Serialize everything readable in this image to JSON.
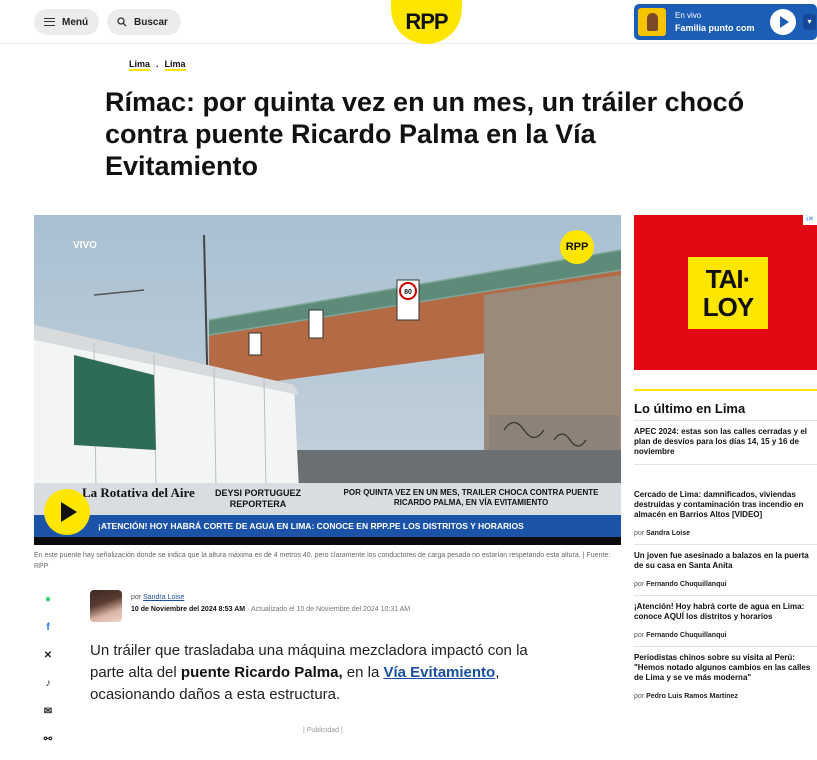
{
  "header": {
    "menu_label": "Menú",
    "search_label": "Buscar",
    "logo": "RPP",
    "live_label": "En vivo",
    "live_program": "Familia punto com"
  },
  "breadcrumb": [
    "Lima",
    "Lima"
  ],
  "article": {
    "title": "Rímac: por quinta vez en un mes, un tráiler chocó contra puente Ricardo Palma en la Vía Evitamiento",
    "video": {
      "live_tag": "VIVO",
      "bug": "RPP",
      "program_name": "La Rotativa del Aire",
      "reporter_name": "DEYSI PORTUGUEZ",
      "reporter_role": "REPORTERA",
      "headline": "POR QUINTA VEZ EN UN MES, TRAILER CHOCA CONTRA PUENTE RICARDO PALMA, EN VÍA EVITAMIENTO",
      "ticker": "¡ATENCIÓN! HOY HABRÁ CORTE DE AGUA EN LIMA: CONOCE EN RPP.PE LOS DISTRITOS Y HORARIOS",
      "sign_speed": "80"
    },
    "caption": "En este puente hay señalización donde se indica que la altura máxima es de 4 metros 40, pero claramente los conductores de carga pesada no estarían respetando esta altura. | Fuente: RPP",
    "author_prefix": "por",
    "author": "Sandra Loise",
    "published": "10 de Noviembre del 2024 8:53 AM",
    "updated": "· Actualizado el 10 de Noviembre del 2024 10:31 AM",
    "body_1": "Un tráiler que trasladaba una máquina mezcladora impactó con la parte alta del ",
    "body_bold": "puente Ricardo Palma,",
    "body_2": " en la ",
    "body_link": "Vía Evitamiento",
    "body_3": ", ocasionando daños a esta estructura.",
    "ad_label": "Publicidad"
  },
  "share_icons": [
    "whatsapp-icon",
    "facebook-icon",
    "x-icon",
    "tiktok-icon",
    "email-icon",
    "link-icon"
  ],
  "ad": {
    "brand_line1": "TAI·",
    "brand_line2": "LOY"
  },
  "sidebar": {
    "title": "Lo último en Lima",
    "items": [
      {
        "title": "APEC 2024: estas son las calles cerradas y el plan de desvíos para los días 14, 15 y 16 de noviembre",
        "author": ""
      },
      {
        "title": "Cercado de Lima: damnificados, viviendas destruidas y contaminación tras incendio en almacén en Barrios Altos [VIDEO]",
        "author": "Sandra Loise"
      },
      {
        "title": "Un joven fue asesinado a balazos en la puerta de su casa en Santa Anita",
        "author": "Fernando Chuquillanqui"
      },
      {
        "title": "¡Atención! Hoy habrá corte de agua en Lima: conoce AQUÍ los distritos y horarios",
        "author": "Fernando Chuquillanqui"
      },
      {
        "title": "Periodistas chinos sobre su visita al Perú: \"Hemos notado algunos cambios en las calles de Lima y se ve más moderna\"",
        "author": "Pedro Luis Ramos Martinez"
      }
    ],
    "by_prefix": "por"
  },
  "colors": {
    "brand_yellow": "#ffe600",
    "live_blue": "#1c5db6",
    "ad_red": "#e30613"
  }
}
